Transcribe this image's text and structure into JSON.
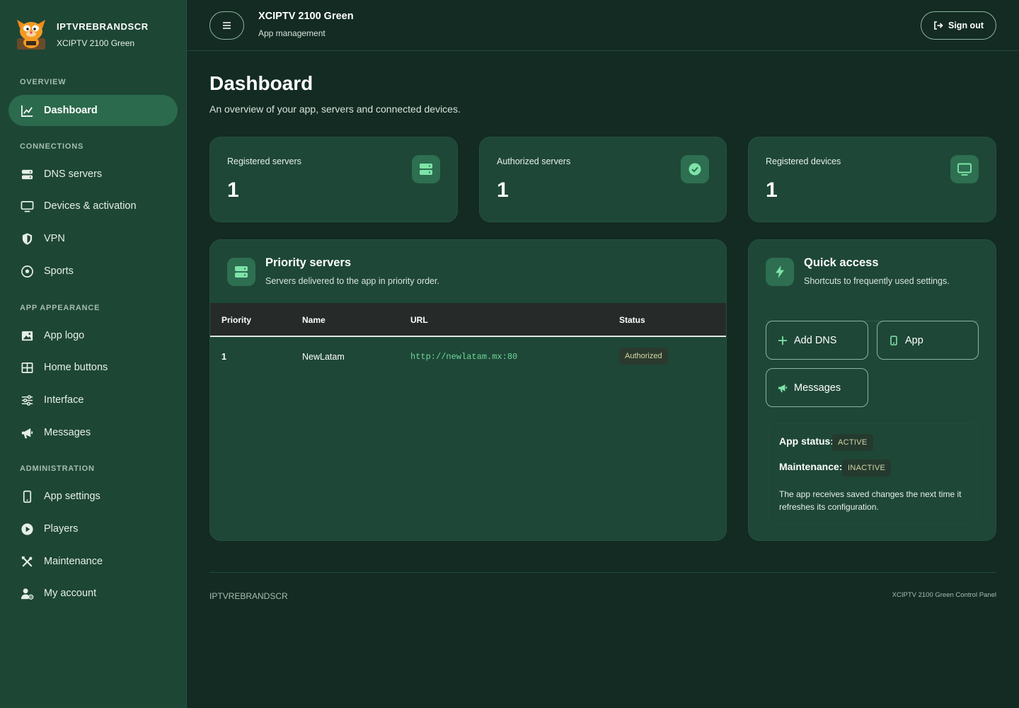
{
  "brand": {
    "name": "IPTVREBRANDSCR",
    "subtitle": "XCIPTV 2100 Green"
  },
  "sidebar": {
    "sections": [
      {
        "label": "OVERVIEW",
        "items": [
          {
            "label": "Dashboard",
            "icon": "chart-line-icon",
            "active": true
          }
        ]
      },
      {
        "label": "CONNECTIONS",
        "items": [
          {
            "label": "DNS servers",
            "icon": "server-icon"
          },
          {
            "label": "Devices & activation",
            "icon": "monitor-icon"
          },
          {
            "label": "VPN",
            "icon": "shield-icon"
          },
          {
            "label": "Sports",
            "icon": "soccer-ball-icon"
          }
        ]
      },
      {
        "label": "APP APPEARANCE",
        "items": [
          {
            "label": "App logo",
            "icon": "image-icon"
          },
          {
            "label": "Home buttons",
            "icon": "grid-icon"
          },
          {
            "label": "Interface",
            "icon": "sliders-icon"
          },
          {
            "label": "Messages",
            "icon": "megaphone-icon"
          }
        ]
      },
      {
        "label": "ADMINISTRATION",
        "items": [
          {
            "label": "App settings",
            "icon": "phone-icon"
          },
          {
            "label": "Players",
            "icon": "play-circle-icon"
          },
          {
            "label": "Maintenance",
            "icon": "tools-icon"
          },
          {
            "label": "My account",
            "icon": "user-gear-icon"
          }
        ]
      }
    ]
  },
  "topbar": {
    "title": "XCIPTV 2100 Green",
    "subtitle": "App management",
    "signout_label": "Sign out"
  },
  "page": {
    "title": "Dashboard",
    "subtitle": "An overview of your app, servers and connected devices."
  },
  "stats": [
    {
      "label": "Registered servers",
      "value": "1",
      "icon": "server-icon"
    },
    {
      "label": "Authorized servers",
      "value": "1",
      "icon": "check-circle-icon"
    },
    {
      "label": "Registered devices",
      "value": "1",
      "icon": "monitor-icon"
    }
  ],
  "priority_servers": {
    "title": "Priority servers",
    "subtitle": "Servers delivered to the app in priority order.",
    "columns": [
      "Priority",
      "Name",
      "URL",
      "Status"
    ],
    "rows": [
      {
        "priority": "1",
        "name": "NewLatam",
        "url": "http://newlatam.mx:80",
        "status": "Authorized"
      }
    ]
  },
  "quick_access": {
    "title": "Quick access",
    "subtitle": "Shortcuts to frequently used settings.",
    "buttons": [
      {
        "label": "Add DNS",
        "icon": "plus-icon"
      },
      {
        "label": "App",
        "icon": "phone-icon"
      },
      {
        "label": "Messages",
        "icon": "megaphone-icon"
      }
    ],
    "app_status_label": "App status:",
    "app_status_value": "ACTIVE",
    "maintenance_label": "Maintenance:",
    "maintenance_value": "INACTIVE",
    "note": "The app receives saved changes the next time it refreshes its configuration."
  },
  "footer": {
    "left": "IPTVREBRANDSCR",
    "right": "XCIPTV 2100 Green Control Panel"
  },
  "colors": {
    "accent": "#6fd79a",
    "sidebar_bg": "#1d4635",
    "page_bg": "#132b22",
    "card_bg": "#1e4737",
    "active_item": "#2b6a4c"
  }
}
